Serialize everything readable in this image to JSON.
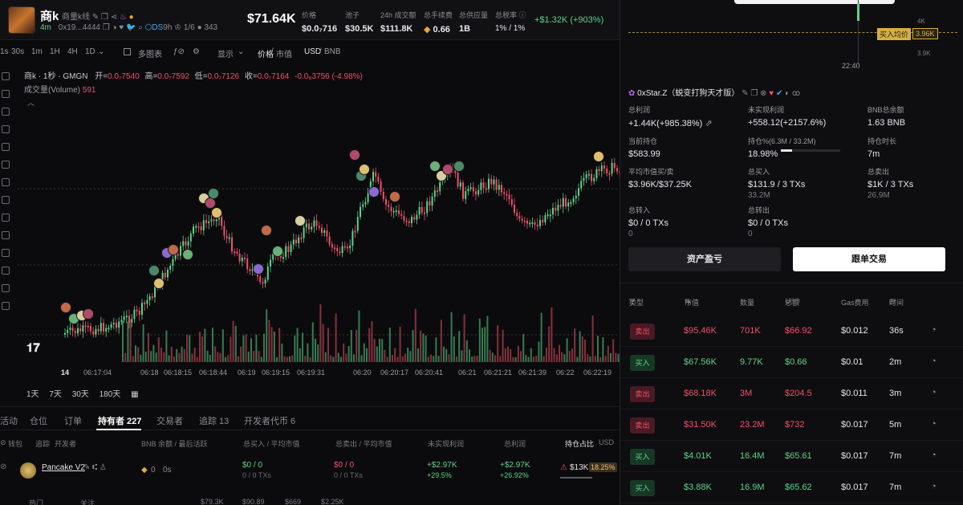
{
  "header": {
    "token_name": "商k",
    "token_sub": "商量k线",
    "age": "4m",
    "address": "0x19...4444",
    "ds": "DS",
    "ds_age": "9h",
    "ratio": "1/6",
    "holders_count": "343",
    "price": "$71.64K",
    "stats": [
      {
        "label": "价格",
        "value": "$0.0₇716"
      },
      {
        "label": "池子",
        "value": "$30.5K"
      },
      {
        "label": "24h 成交额",
        "value": "$111.8K"
      },
      {
        "label": "总手续费",
        "value": "0.66"
      },
      {
        "label": "总供应量",
        "value": "1B"
      },
      {
        "label": "总税率",
        "value": "1% / 1%"
      }
    ],
    "pnl": "+$1.32K (+903%)"
  },
  "toolbar": {
    "intervals": [
      "1s",
      "30s",
      "1m",
      "1H",
      "4H",
      "1D"
    ],
    "multi_chart": "多图表",
    "display": "显示",
    "price_label": "价格",
    "mcap_label": "市值",
    "usd": "USD",
    "bnb": "BNB"
  },
  "chart_info": {
    "title": "商k · 1秒 · GMGN",
    "open_label": "开=",
    "open": "0.0₇7540",
    "high_label": "高=",
    "high": "0.0₇7592",
    "low_label": "低=",
    "low": "0.0₇7126",
    "close_label": "收=",
    "close": "0.0₇7164",
    "change": "-0.0₈3756 (-4.98%)",
    "volume_label": "成交量(Volume)",
    "volume": "591"
  },
  "time_ticks": [
    "14",
    "06:17:04",
    "06:18",
    "06:18:15",
    "06:18:44",
    "06:19",
    "06:19:15",
    "06:19:31",
    "06:20",
    "06:20:17",
    "06:20:41",
    "06:21",
    "06:21:21",
    "06:21:39",
    "06:22",
    "06:22:19"
  ],
  "periods": [
    "1天",
    "7天",
    "30天",
    "180天"
  ],
  "tabs": [
    "活动",
    "仓位",
    "订单",
    "持有者 227",
    "交易者",
    "追踪 13",
    "开发者代币 6"
  ],
  "holders_table": {
    "headers": [
      "钱包",
      "追踪",
      "开发者",
      "BNB 余额 / 最后活跃",
      "总买入 / 平均市值",
      "总卖出 / 平均市值",
      "未实现利润",
      "总利润",
      "持仓占比",
      "USD"
    ],
    "row": {
      "name": "Pancake V2",
      "bnb": "0",
      "active": "0s",
      "buy": "$0 / 0",
      "buy_tx": "0 / 0 TXs",
      "sell": "$0 / 0",
      "sell_tx": "0 / 0 TXs",
      "unrealized": "+$2.97K",
      "unrealized_pct": "+29.5%",
      "total": "+$2.97K",
      "total_pct": "+26.92%",
      "hold_value": "$13K",
      "hold_pct": "18.25%"
    }
  },
  "bottom_bar": [
    "热门",
    "关注",
    "$79.3K",
    "$90.89",
    "$669",
    "$2.25K"
  ],
  "right_panel": {
    "mini_chart": {
      "y_high": "4K",
      "y_low": "3.9K",
      "avg_buy_label": "买入均价",
      "avg_buy_value": "3.96K",
      "time": "22:40"
    },
    "trader_name": "0xStar.Z（蜕变打狗天才版）",
    "metrics": {
      "total_profit": {
        "label": "总利润",
        "value": "+1.44K(+985.38%)"
      },
      "unrealized": {
        "label": "未实现利润",
        "value": "+558.12(+2157.6%)"
      },
      "bnb_balance": {
        "label": "BNB总余额",
        "value": "1.63 BNB"
      },
      "holding": {
        "label": "当前持仓",
        "value": "$583.99"
      },
      "hold_pct": {
        "label": "持仓%(6.3M / 33.2M)",
        "value": "18.98%",
        "fill": 0.19
      },
      "hold_time": {
        "label": "持仓时长",
        "value": "7m"
      },
      "avg_mcap": {
        "label": "平均市值买/卖",
        "value": "$3.96K/$37.25K"
      },
      "total_buy": {
        "label": "总买入",
        "value": "$131.9",
        "tx": "3 TXs",
        "sub": "33.2M"
      },
      "total_sell": {
        "label": "总卖出",
        "value": "$1K",
        "tx": "3 TXs",
        "sub": "26.9M"
      },
      "transfer_in": {
        "label": "总转入",
        "value": "$0",
        "tx": "0 TXs",
        "sub": "0"
      },
      "transfer_out": {
        "label": "总转出",
        "value": "$0",
        "tx": "0 TXs",
        "sub": "0"
      }
    },
    "btn_pnl": "资产盈亏",
    "btn_copy": "跟单交易",
    "tx_headers": [
      "类型",
      "市值",
      "数量",
      "总额",
      "USD",
      "Gas费用",
      "时间"
    ],
    "txs": [
      {
        "type": "卖出",
        "side": "sell",
        "mcap": "$95.46K",
        "amount": "701K",
        "total": "$66.92",
        "gas": "$0.012",
        "time": "36s"
      },
      {
        "type": "买入",
        "side": "buy",
        "mcap": "$67.56K",
        "amount": "9.77K",
        "total": "$0.66",
        "gas": "$0.01",
        "time": "2m"
      },
      {
        "type": "卖出",
        "side": "sell",
        "mcap": "$68.18K",
        "amount": "3M",
        "total": "$204.5",
        "gas": "$0.011",
        "time": "3m"
      },
      {
        "type": "卖出",
        "side": "sell",
        "mcap": "$31.50K",
        "amount": "23.2M",
        "total": "$732",
        "gas": "$0.017",
        "time": "5m"
      },
      {
        "type": "买入",
        "side": "buy",
        "mcap": "$4.01K",
        "amount": "16.4M",
        "total": "$65.61",
        "gas": "$0.017",
        "time": "7m"
      },
      {
        "type": "买入",
        "side": "buy",
        "mcap": "$3.88K",
        "amount": "16.9M",
        "total": "$65.62",
        "gas": "$0.017",
        "time": "7m"
      }
    ]
  },
  "colors": {
    "green": "#5cd38a",
    "red": "#f0506b",
    "bg": "#0b0b0d",
    "panel": "#0e0e11"
  }
}
